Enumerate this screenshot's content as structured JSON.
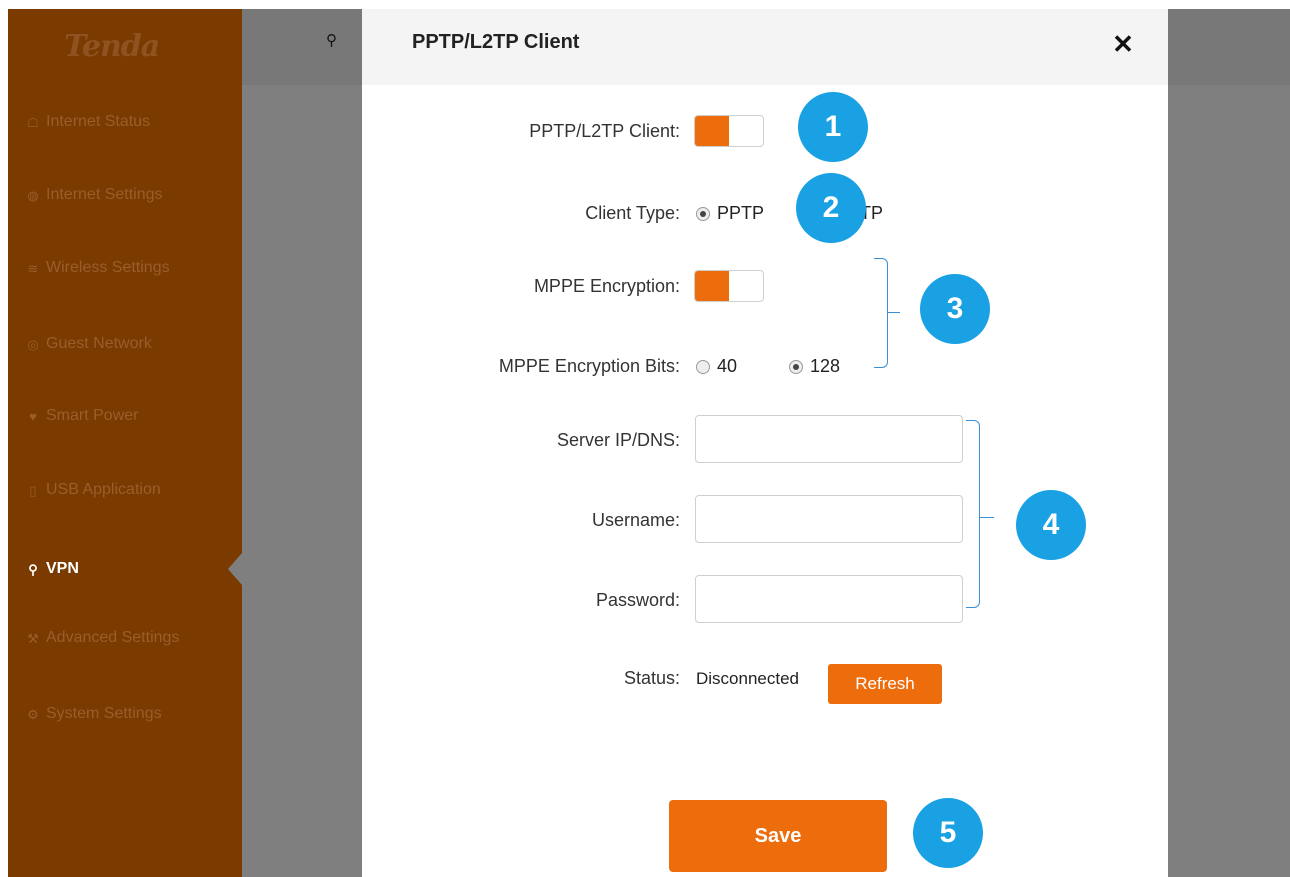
{
  "app": {
    "logo": "Tenda",
    "nav_items": [
      {
        "label": "Internet Status",
        "icon": "router-icon"
      },
      {
        "label": "Internet Settings",
        "icon": "globe-icon"
      },
      {
        "label": "Wireless Settings",
        "icon": "wifi-icon"
      },
      {
        "label": "Guest Network",
        "icon": "guest-icon"
      },
      {
        "label": "Smart Power",
        "icon": "bulb-icon"
      },
      {
        "label": "USB Application",
        "icon": "usb-icon"
      },
      {
        "label": "VPN",
        "icon": "vpn-icon",
        "active": true
      },
      {
        "label": "Advanced Settings",
        "icon": "wrench-icon"
      },
      {
        "label": "System Settings",
        "icon": "gear-icon"
      }
    ]
  },
  "modal": {
    "title": "PPTP/L2TP Client",
    "close_icon": "close-icon",
    "client_enable": {
      "label": "PPTP/L2TP Client:",
      "on": true
    },
    "client_type": {
      "label": "Client Type:",
      "options": [
        "PPTP",
        "L2TP"
      ],
      "selected": "PPTP",
      "visible_fragment_l2tp": "2TP"
    },
    "mppe_encryption": {
      "label": "MPPE Encryption:",
      "on": true
    },
    "mppe_bits": {
      "label": "MPPE Encryption Bits:",
      "options": [
        "40",
        "128"
      ],
      "selected": "128"
    },
    "server": {
      "label": "Server IP/DNS:",
      "value": ""
    },
    "username": {
      "label": "Username:",
      "value": ""
    },
    "password": {
      "label": "Password:",
      "value": ""
    },
    "status": {
      "label": "Status:",
      "value": "Disconnected",
      "refresh_label": "Refresh"
    },
    "save_label": "Save"
  },
  "callouts": [
    "1",
    "2",
    "3",
    "4",
    "5"
  ],
  "colors": {
    "accent": "#ed6c0c",
    "callout": "#1aa1e4",
    "sidebar": "#7a3a00"
  }
}
